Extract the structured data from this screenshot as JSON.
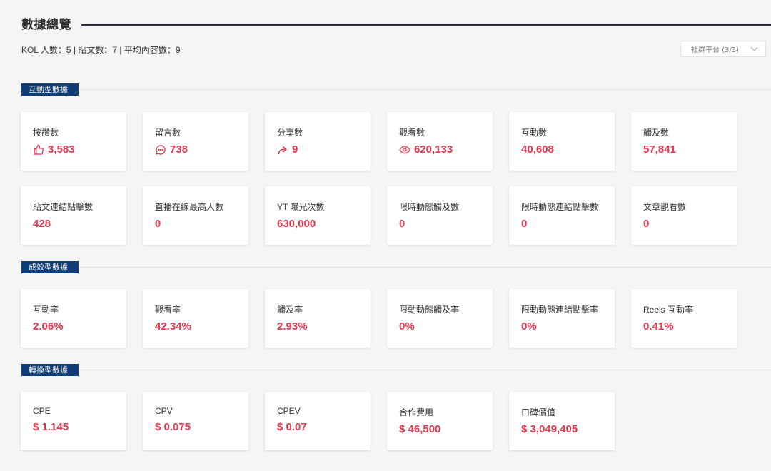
{
  "header": {
    "title": "數據總覽",
    "summary": "KOL 人數：5 | 貼文數：7 | 平均內容數：9",
    "platform_select": "社群平台 (3/3)"
  },
  "sections": [
    {
      "tag": "互動型數據",
      "cards": [
        {
          "label": "按讚數",
          "value": "3,583",
          "icon": "thumbs-up-icon"
        },
        {
          "label": "留言數",
          "value": "738",
          "icon": "comment-icon"
        },
        {
          "label": "分享數",
          "value": "9",
          "icon": "share-icon"
        },
        {
          "label": "觀看數",
          "value": "620,133",
          "icon": "eye-icon"
        },
        {
          "label": "互動數",
          "value": "40,608"
        },
        {
          "label": "觸及數",
          "value": "57,841"
        },
        {
          "label": "貼文連結點擊數",
          "value": "428"
        },
        {
          "label": "直播在線最高人數",
          "value": "0"
        },
        {
          "label": "YT 曝光次數",
          "value": "630,000"
        },
        {
          "label": "限時動態觸及數",
          "value": "0"
        },
        {
          "label": "限時動態連結點擊數",
          "value": "0"
        },
        {
          "label": "文章觀看數",
          "value": "0"
        }
      ]
    },
    {
      "tag": "成效型數據",
      "cards": [
        {
          "label": "互動率",
          "value": "2.06%"
        },
        {
          "label": "觀看率",
          "value": "42.34%"
        },
        {
          "label": "觸及率",
          "value": "2.93%"
        },
        {
          "label": "限動動態觸及率",
          "value": "0%"
        },
        {
          "label": "限動動態連結點擊率",
          "value": "0%"
        },
        {
          "label": "Reels 互動率",
          "value": "0.41%"
        }
      ]
    },
    {
      "tag": "轉換型數據",
      "cards": [
        {
          "label": "CPE",
          "value": "$ 1.145"
        },
        {
          "label": "CPV",
          "value": "$ 0.075"
        },
        {
          "label": "CPEV",
          "value": "$ 0.07"
        },
        {
          "label": "合作費用",
          "value": "$ 46,500"
        },
        {
          "label": "口碑價值",
          "value": "$ 3,049,405"
        }
      ]
    }
  ],
  "colors": {
    "accent": "#e8374f",
    "tag_bg": "#0f3d78"
  }
}
